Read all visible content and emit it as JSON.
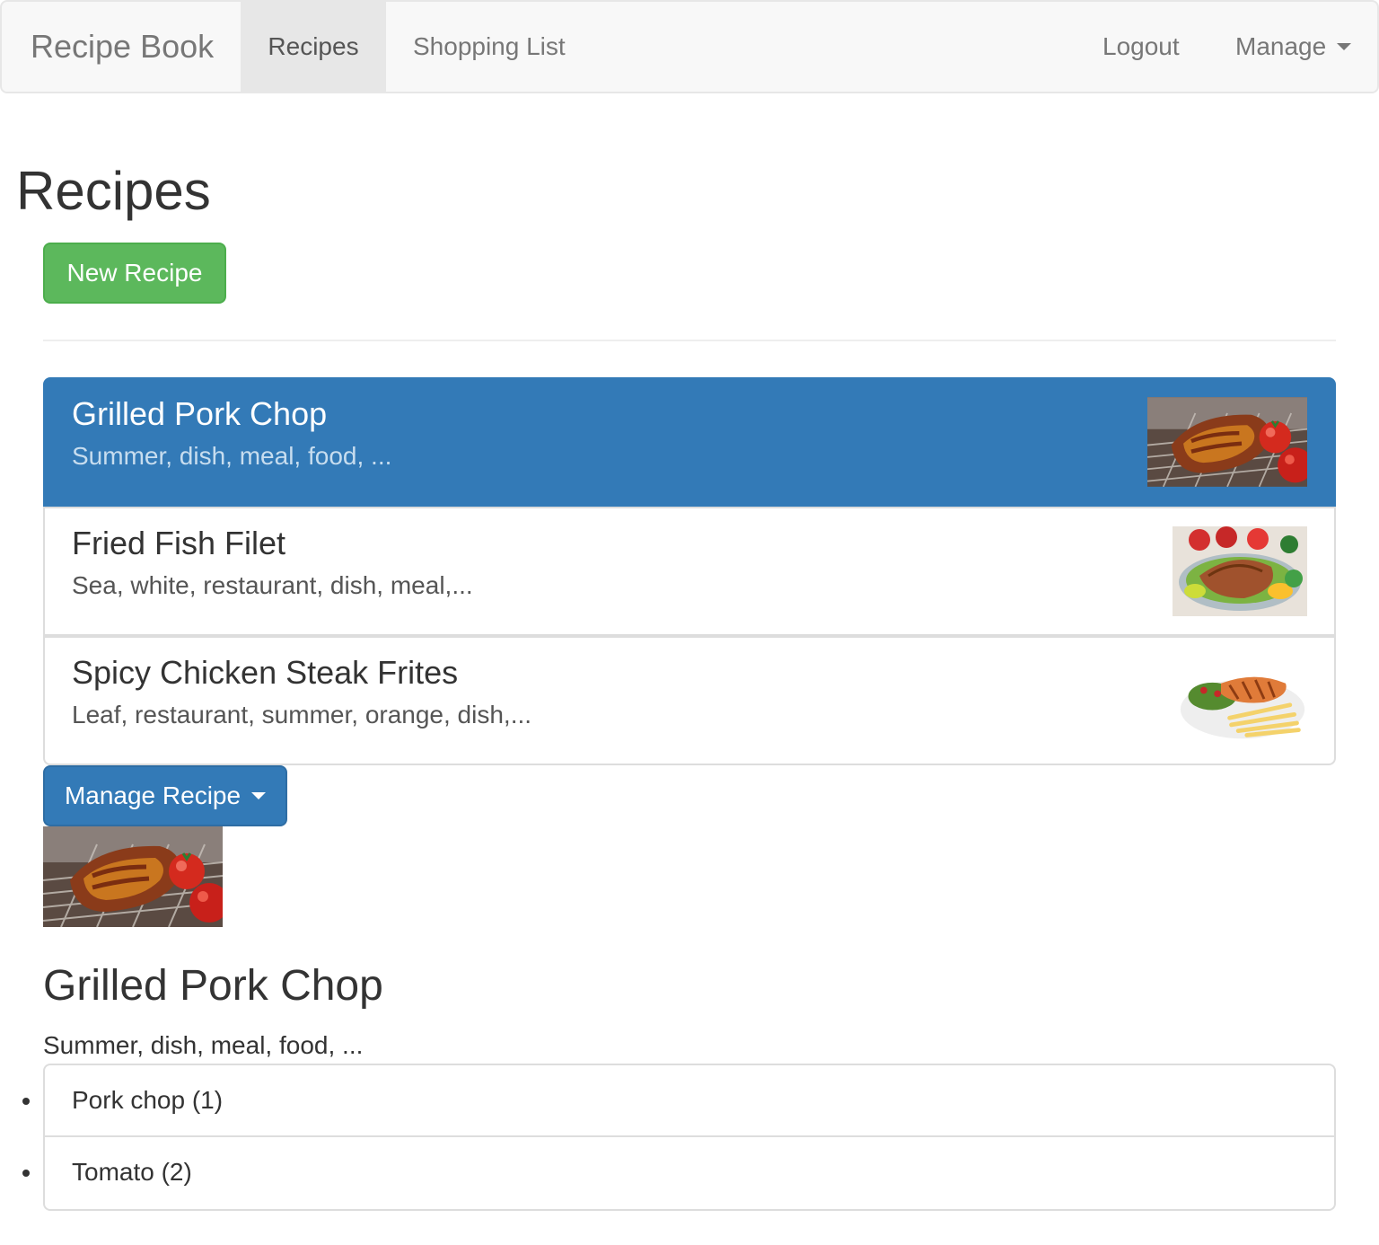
{
  "navbar": {
    "brand": "Recipe Book",
    "recipes": "Recipes",
    "shopping_list": "Shopping List",
    "logout": "Logout",
    "manage": "Manage"
  },
  "page": {
    "title": "Recipes",
    "new_recipe": "New Recipe"
  },
  "recipes": [
    {
      "name": "Grilled Pork Chop",
      "description": "Summer, dish, meal, food, ...",
      "image": "grilled-pork-chop",
      "active": true
    },
    {
      "name": "Fried Fish Filet",
      "description": "Sea, white, restaurant, dish, meal,...",
      "image": "fried-fish-filet",
      "active": false
    },
    {
      "name": "Spicy Chicken Steak Frites",
      "description": "Leaf, restaurant, summer, orange, dish,...",
      "image": "spicy-chicken-steak-frites",
      "active": false
    }
  ],
  "detail": {
    "manage_recipe": "Manage Recipe",
    "image": "grilled-pork-chop",
    "name": "Grilled Pork Chop",
    "description": "Summer, dish, meal, food, ...",
    "ingredients": [
      "Pork chop (1)",
      "Tomato (2)"
    ]
  },
  "colors": {
    "primary": "#337ab7",
    "success": "#5cb85c",
    "navbar_bg": "#f8f8f8"
  }
}
